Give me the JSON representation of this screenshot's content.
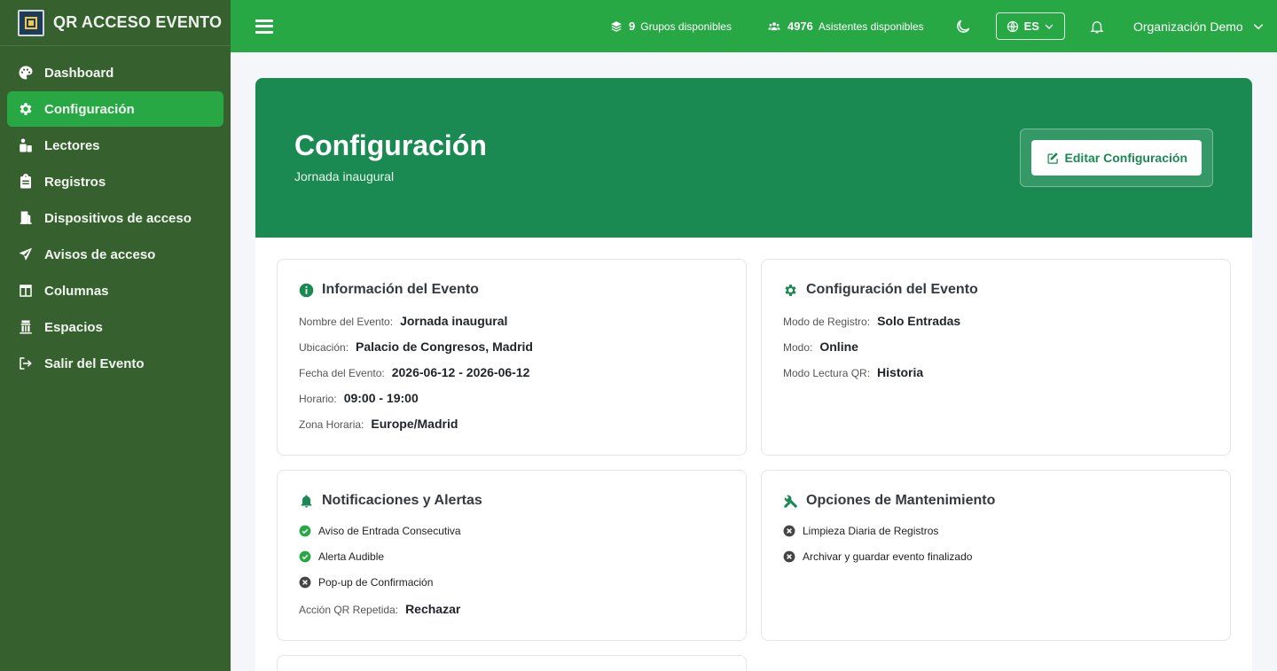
{
  "brand": {
    "name": "QR ACCESO EVENTO"
  },
  "sidebar": {
    "items": [
      {
        "label": "Dashboard",
        "icon": "palette-icon",
        "active": false
      },
      {
        "label": "Configuración",
        "icon": "gear-icon",
        "active": true
      },
      {
        "label": "Lectores",
        "icon": "reader-icon",
        "active": false
      },
      {
        "label": "Registros",
        "icon": "clipboard-icon",
        "active": false
      },
      {
        "label": "Dispositivos de acceso",
        "icon": "door-icon",
        "active": false
      },
      {
        "label": "Avisos de acceso",
        "icon": "paper-plane-icon",
        "active": false
      },
      {
        "label": "Columnas",
        "icon": "columns-icon",
        "active": false
      },
      {
        "label": "Espacios",
        "icon": "building-icon",
        "active": false
      },
      {
        "label": "Salir del Evento",
        "icon": "logout-icon",
        "active": false
      }
    ]
  },
  "topbar": {
    "groups_count": "9",
    "groups_label": "Grupos disponibles",
    "attendees_count": "4976",
    "attendees_label": "Asistentes disponibles",
    "language": "ES",
    "organization": "Organización Demo"
  },
  "header": {
    "title": "Configuración",
    "subtitle": "Jornada inaugural",
    "edit_button": "Editar Configuración"
  },
  "event_info": {
    "title": "Información del Evento",
    "rows": [
      {
        "k": "Nombre del Evento:",
        "v": "Jornada inaugural"
      },
      {
        "k": "Ubicación:",
        "v": "Palacio de Congresos, Madrid"
      },
      {
        "k": "Fecha del Evento:",
        "v": "2026-06-12 - 2026-06-12"
      },
      {
        "k": "Horario:",
        "v": "09:00 - 19:00"
      },
      {
        "k": "Zona Horaria:",
        "v": "Europe/Madrid"
      }
    ]
  },
  "event_config": {
    "title": "Configuración del Evento",
    "rows": [
      {
        "k": "Modo de Registro:",
        "v": "Solo Entradas"
      },
      {
        "k": "Modo:",
        "v": "Online"
      },
      {
        "k": "Modo Lectura QR:",
        "v": "Historia"
      }
    ]
  },
  "notifications": {
    "title": "Notificaciones y Alertas",
    "items": [
      {
        "label": "Aviso de Entrada Consecutiva",
        "enabled": true
      },
      {
        "label": "Alerta Audible",
        "enabled": true
      },
      {
        "label": "Pop-up de Confirmación",
        "enabled": false
      }
    ],
    "repeat_key": "Acción QR Repetida:",
    "repeat_value": "Rechazar"
  },
  "maintenance": {
    "title": "Opciones de Mantenimiento",
    "items": [
      {
        "label": "Limpieza Diaria de Registros",
        "enabled": false
      },
      {
        "label": "Archivar y guardar evento finalizado",
        "enabled": false
      }
    ]
  },
  "colors": {
    "sidebar": "#36602e",
    "topbar": "#28a745",
    "hero": "#1a8a52",
    "check": "#28a745",
    "cross": "#444444"
  }
}
